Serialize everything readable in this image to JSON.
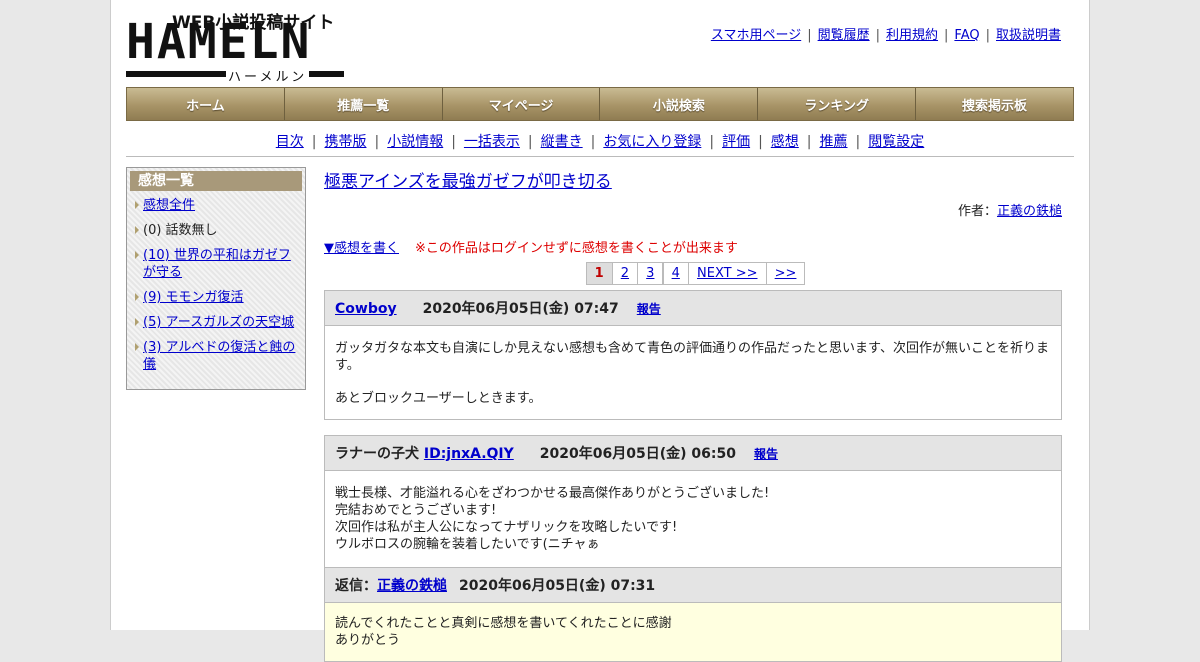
{
  "logo": {
    "small_text": "WEB小説投稿サイト",
    "big_text": "HAMELN",
    "kana_text": "ハーメルン"
  },
  "top_links": [
    "スマホ用ページ",
    "閲覧履歴",
    "利用規約",
    "FAQ",
    "取扱説明書"
  ],
  "main_nav": [
    "ホーム",
    "推薦一覧",
    "マイページ",
    "小説検索",
    "ランキング",
    "捜索掲示板"
  ],
  "sub_nav": [
    "目次",
    "携帯版",
    "小説情報",
    "一括表示",
    "縦書き",
    "お気に入り登録",
    "評価",
    "感想",
    "推薦",
    "閲覧設定"
  ],
  "sidebar": {
    "title": "感想一覧",
    "items": [
      "感想全件",
      "(0) 話数無し",
      "(10) 世界の平和はガゼフが守る",
      "(9) モモンガ復活",
      "(5) アースガルズの天空城",
      "(3) アルベドの復活と蝕の儀"
    ]
  },
  "work": {
    "title": "極悪アインズを最強ガゼフが叩き切る",
    "author_label": "作者：",
    "author_name": "正義の鉄槌",
    "write_link": "▼感想を書く",
    "notice": "※この作品はログインせずに感想を書くことが出来ます"
  },
  "pager": [
    "1",
    "2",
    "3",
    "4",
    "NEXT >>",
    ">>"
  ],
  "comments": [
    {
      "user": "Cowboy",
      "date": "2020年06月05日(金) 07:47",
      "report": "報告",
      "body1": "ガッタガタな本文も自演にしか見えない感想も含めて青色の評価通りの作品だったと思います、次回作が無いことを祈ります。",
      "body2": "あとブロックユーザーしときます。"
    },
    {
      "user_prefix": "ラナーの子犬",
      "user_id": "ID:jnxA.QIY",
      "date": "2020年06月05日(金) 06:50",
      "report": "報告",
      "lines": [
        "戦士長様、才能溢れる心をざわつかせる最高傑作ありがとうございました!",
        "完結おめでとうございます!",
        "次回作は私が主人公になってナザリックを攻略したいです!",
        "ウルボロスの腕輪を装着したいです(ニチャぁ"
      ],
      "reply": {
        "label": "返信：",
        "name": "正義の鉄槌",
        "date": "2020年06月05日(金) 07:31",
        "lines": [
          "読んでくれたことと真剣に感想を書いてくれたことに感謝",
          "ありがとう"
        ]
      }
    }
  ]
}
